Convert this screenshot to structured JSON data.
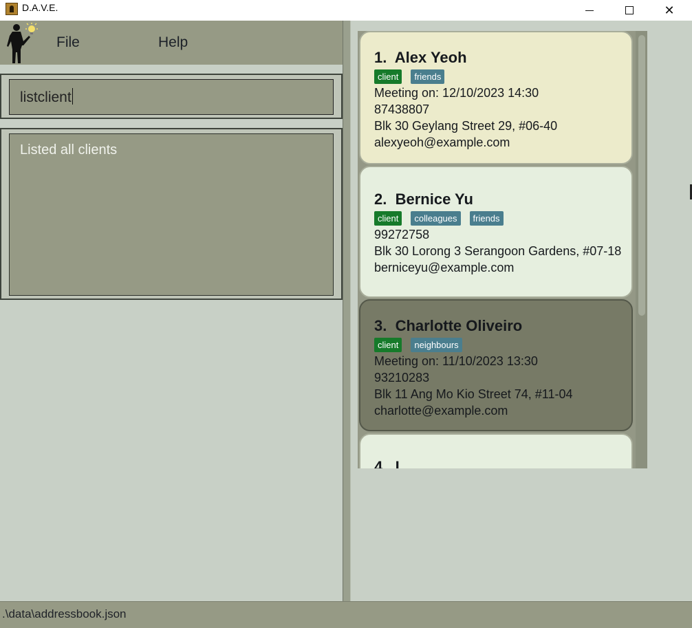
{
  "window": {
    "title": "D.A.V.E.",
    "controls": {
      "minimize": "—",
      "maximize": "☐",
      "close": "✕"
    }
  },
  "menu": {
    "file_label": "File",
    "help_label": "Help"
  },
  "command": {
    "value": "listclient"
  },
  "result": {
    "message": "Listed all clients"
  },
  "persons": [
    {
      "index": "1.",
      "name": "Alex Yeoh",
      "tags": [
        "client",
        "friends"
      ],
      "meeting": "Meeting on: 12/10/2023 14:30",
      "phone": "87438807",
      "address": "Blk 30 Geylang Street 29, #06-40",
      "email": "alexyeoh@example.com"
    },
    {
      "index": "2.",
      "name": "Bernice Yu",
      "tags": [
        "client",
        "colleagues",
        "friends"
      ],
      "phone": "99272758",
      "address": "Blk 30 Lorong 3 Serangoon Gardens, #07-18",
      "email": "berniceyu@example.com"
    },
    {
      "index": "3.",
      "name": "Charlotte Oliveiro",
      "tags": [
        "client",
        "neighbours"
      ],
      "meeting": "Meeting on: 11/10/2023 13:30",
      "phone": "93210283",
      "address": "Blk 11 Ang Mo Kio Street 74, #11-04",
      "email": "charlotte@example.com"
    },
    {
      "index": "4.",
      "name": "I"
    }
  ],
  "status": {
    "file_path": ".\\data\\addressbook.json"
  },
  "colors": {
    "tag_client": "#167a2a",
    "tag_other": "#4a7e8e",
    "menubar": "#969a85",
    "selected_card": "#777a66"
  }
}
